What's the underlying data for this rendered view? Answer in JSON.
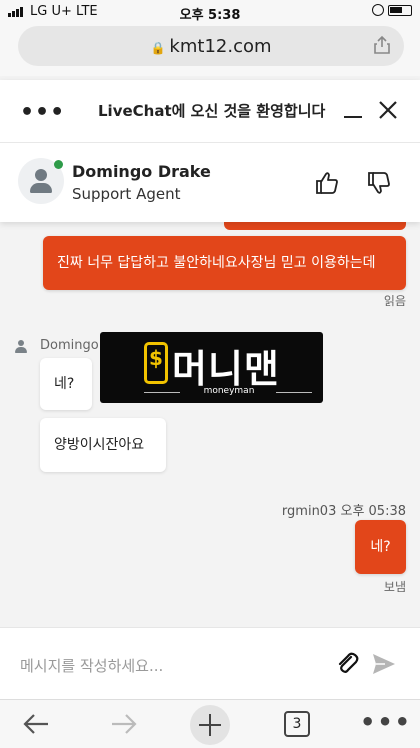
{
  "status_bar": {
    "carrier": "LG U+  LTE",
    "time": "오후 5:38"
  },
  "browser": {
    "url": "kmt12.com",
    "tab_count": "3"
  },
  "chat_header": {
    "title": "LiveChat에 오신 것을 환영합니다",
    "agent_name": "Domingo Drake",
    "agent_role": "Support Agent",
    "agent_status_color": "#2e9b49"
  },
  "messages": {
    "user_long": "진짜 너무 답답하고 불안하네요사장님 믿고 이용하는데",
    "read_label": "읽음",
    "agent_label": "Domingo",
    "agent_msg_1": "네?",
    "agent_msg_2": "양방이시잔아요",
    "sender_meta": "rgmin03 오후 05:38",
    "user_short": "네?",
    "sent_label": "보냄"
  },
  "watermark": {
    "brand": "머니맨",
    "sub": "moneyman"
  },
  "composer": {
    "placeholder": "메시지를 작성하세요..."
  },
  "colors": {
    "accent": "#e2461a",
    "agent_bubble": "#ffffff",
    "logo_yellow": "#f2c300"
  },
  "icons": [
    "signal-icon",
    "alarm-icon",
    "battery-icon",
    "padlock-icon",
    "share-icon",
    "more-dots-icon",
    "minimize-icon",
    "close-icon",
    "avatar-icon",
    "thumbs-up-icon",
    "thumbs-down-icon",
    "paperclip-icon",
    "send-icon",
    "back-arrow-icon",
    "forward-arrow-icon",
    "plus-icon",
    "tabs-icon",
    "ellipsis-icon"
  ]
}
